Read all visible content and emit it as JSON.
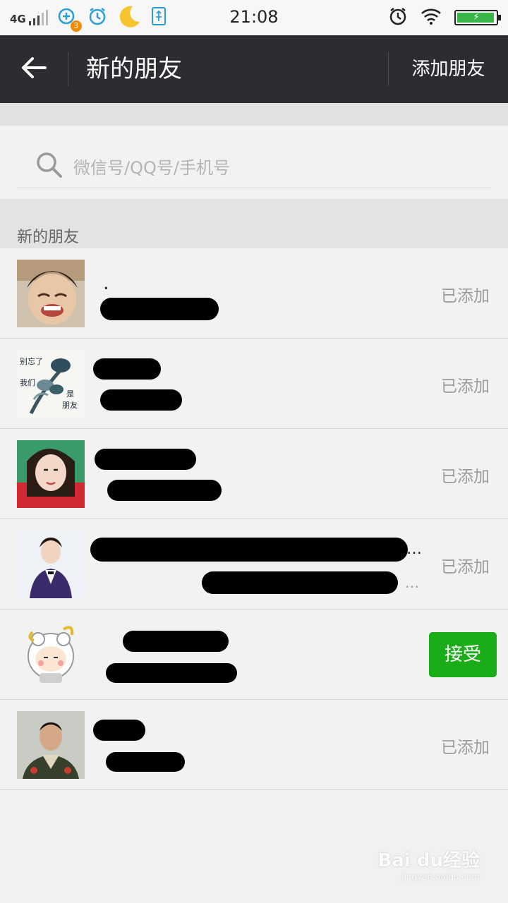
{
  "status_bar": {
    "network": "4G",
    "notification_count": "3",
    "time": "21:08"
  },
  "header": {
    "title": "新的朋友",
    "add_label": "添加朋友"
  },
  "search": {
    "placeholder": "微信号/QQ号/手机号"
  },
  "section": {
    "label": "新的朋友"
  },
  "contacts": [
    {
      "name": ".",
      "message": "",
      "status": "已添加"
    },
    {
      "name": "",
      "message": "",
      "status": "已添加"
    },
    {
      "name": "",
      "message": "",
      "status": "已添加"
    },
    {
      "name": "",
      "message": "",
      "status": "已添加"
    },
    {
      "name": "",
      "message": "",
      "status": "接受"
    },
    {
      "name": "",
      "message": "",
      "status": "已添加"
    }
  ],
  "watermark": {
    "brand": "Bai du经验",
    "url": "jingyan.baidu.com"
  },
  "colors": {
    "header_bg": "#2b2d31",
    "accept_green": "#1aad19",
    "battery_green": "#3ab54a"
  }
}
